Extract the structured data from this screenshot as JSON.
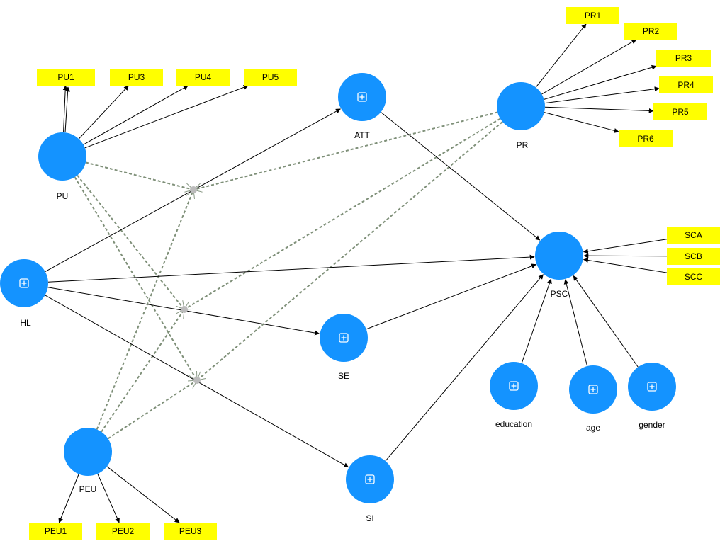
{
  "diagram": {
    "type": "structural-equation-model",
    "colors": {
      "latent_fill": "#1493FF",
      "indicator_fill": "#FFFF00",
      "path_line": "#000000",
      "moderator_line": "#7f9079",
      "moderator_dot": "#bbbbbb",
      "expand_icon": "#ffffff"
    },
    "latent_variables": [
      {
        "id": "PU",
        "label": "PU",
        "expandable": false
      },
      {
        "id": "PR",
        "label": "PR",
        "expandable": false
      },
      {
        "id": "ATT",
        "label": "ATT",
        "expandable": true
      },
      {
        "id": "HL",
        "label": "HL",
        "expandable": true
      },
      {
        "id": "SE",
        "label": "SE",
        "expandable": true
      },
      {
        "id": "SI",
        "label": "SI",
        "expandable": true
      },
      {
        "id": "PEU",
        "label": "PEU",
        "expandable": false
      },
      {
        "id": "PSC",
        "label": "PSC",
        "expandable": false
      },
      {
        "id": "education",
        "label": "education",
        "expandable": true
      },
      {
        "id": "age",
        "label": "age",
        "expandable": true
      },
      {
        "id": "gender",
        "label": "gender",
        "expandable": true
      }
    ],
    "indicators": [
      {
        "id": "PU1",
        "label": "PU1",
        "latent": "PU"
      },
      {
        "id": "PU3",
        "label": "PU3",
        "latent": "PU"
      },
      {
        "id": "PU4",
        "label": "PU4",
        "latent": "PU"
      },
      {
        "id": "PU5",
        "label": "PU5",
        "latent": "PU"
      },
      {
        "id": "PR1",
        "label": "PR1",
        "latent": "PR"
      },
      {
        "id": "PR2",
        "label": "PR2",
        "latent": "PR"
      },
      {
        "id": "PR3",
        "label": "PR3",
        "latent": "PR"
      },
      {
        "id": "PR4",
        "label": "PR4",
        "latent": "PR"
      },
      {
        "id": "PR5",
        "label": "PR5",
        "latent": "PR"
      },
      {
        "id": "PR6",
        "label": "PR6",
        "latent": "PR"
      },
      {
        "id": "SCA",
        "label": "SCA",
        "latent": "PSC"
      },
      {
        "id": "SCB",
        "label": "SCB",
        "latent": "PSC"
      },
      {
        "id": "SCC",
        "label": "SCC",
        "latent": "PSC"
      },
      {
        "id": "PEU1",
        "label": "PEU1",
        "latent": "PEU"
      },
      {
        "id": "PEU2",
        "label": "PEU2",
        "latent": "PEU"
      },
      {
        "id": "PEU3",
        "label": "PEU3",
        "latent": "PEU"
      }
    ],
    "structural_paths": [
      {
        "from": "HL",
        "to": "ATT"
      },
      {
        "from": "HL",
        "to": "PSC"
      },
      {
        "from": "HL",
        "to": "SE"
      },
      {
        "from": "HL",
        "to": "SI"
      },
      {
        "from": "ATT",
        "to": "PSC"
      },
      {
        "from": "SE",
        "to": "PSC"
      },
      {
        "from": "SI",
        "to": "PSC"
      },
      {
        "from": "education",
        "to": "PSC"
      },
      {
        "from": "age",
        "to": "PSC"
      },
      {
        "from": "gender",
        "to": "PSC"
      }
    ],
    "moderating_effects": [
      {
        "id": "M1",
        "sources": [
          "PU",
          "PEU",
          "PR"
        ]
      },
      {
        "id": "M2",
        "sources": [
          "PU",
          "PEU",
          "PR"
        ]
      },
      {
        "id": "M3",
        "sources": [
          "PU",
          "PEU",
          "PR"
        ]
      }
    ]
  }
}
